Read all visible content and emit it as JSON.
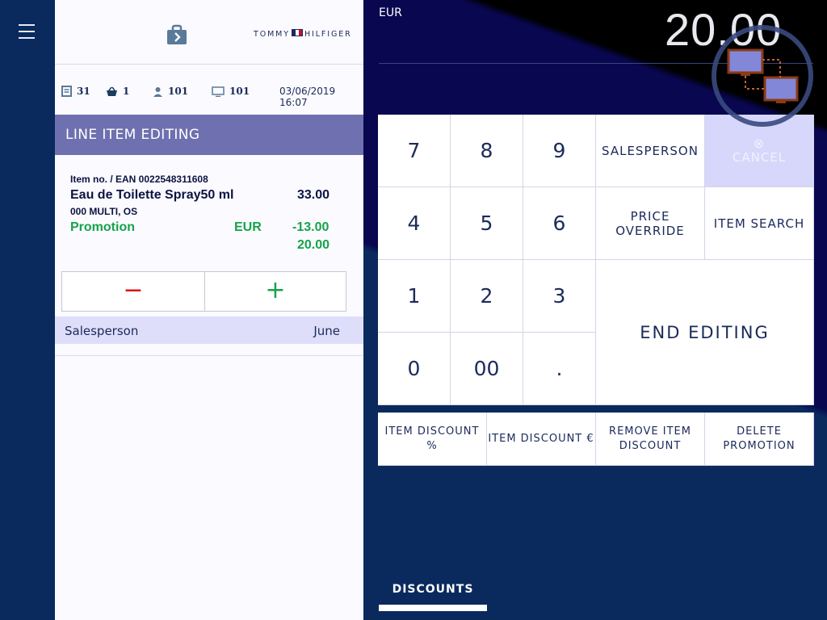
{
  "nav": {
    "menu_icon": "hamburger-icon"
  },
  "header": {
    "bag_icon": "shopping-bag-arrow-icon",
    "brand": {
      "left": "TOMMY",
      "right": "HILFIGER"
    },
    "stats": [
      {
        "icon": "receipt-icon",
        "value": "31"
      },
      {
        "icon": "basket-icon",
        "value": "1"
      },
      {
        "icon": "person-icon",
        "value": "101"
      },
      {
        "icon": "monitor-icon",
        "value": "101"
      }
    ],
    "datetime": "03/06/2019 16:07"
  },
  "panel": {
    "title": "LINE ITEM EDITING",
    "item": {
      "ean_line": "Item no. / EAN 0022548311608",
      "name": "Eau de Toilette Spray50 ml",
      "price": "33.00",
      "variant": "000 MULTI, OS",
      "promo_label": "Promotion",
      "promo_currency": "EUR",
      "promo_amount": "-13.00",
      "total": "20.00"
    },
    "qty": {
      "minus": "−",
      "plus": "+"
    },
    "salesperson": {
      "label": "Salesperson",
      "value": "June"
    }
  },
  "display": {
    "currency": "EUR",
    "amount": "20.00",
    "status_icon": "network-computers-icon"
  },
  "keypad": {
    "k7": "7",
    "k8": "8",
    "k9": "9",
    "k4": "4",
    "k5": "5",
    "k6": "6",
    "k1": "1",
    "k2": "2",
    "k3": "3",
    "k0": "0",
    "k00": "00",
    "kdot": ".",
    "salesperson": "SALESPERSON",
    "cancel": "CANCEL",
    "price_override": "PRICE OVERRIDE",
    "item_search": "ITEM SEARCH",
    "end_editing": "END EDITING"
  },
  "discounts": {
    "item_pct": "ITEM DISCOUNT %",
    "item_eur": "ITEM DISCOUNT €",
    "remove_l1": "REMOVE ITEM",
    "remove_l2": "DISCOUNT",
    "delete_l1": "DELETE",
    "delete_l2": "PROMOTION"
  },
  "tabs": {
    "discounts": "DISCOUNTS"
  },
  "colors": {
    "accent": "#6e70b0",
    "green": "#16a34a",
    "red": "#dd1111",
    "nav": "#0a2a5e",
    "bg": "#08074f"
  }
}
